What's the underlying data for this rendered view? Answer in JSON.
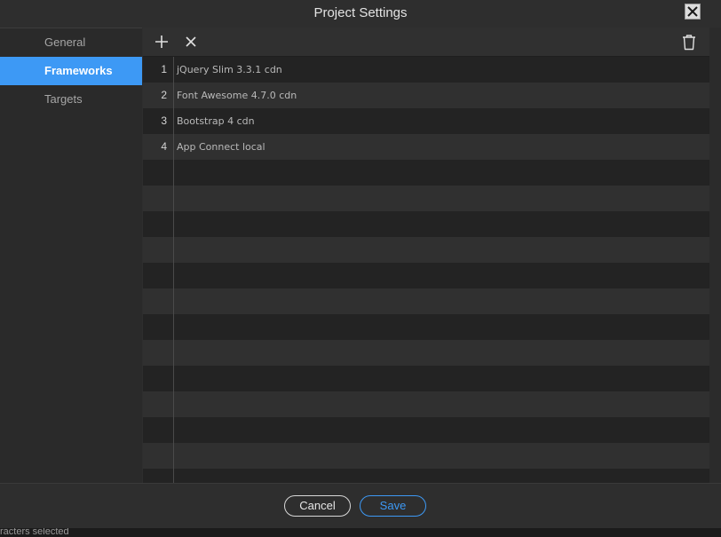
{
  "dialog": {
    "title": "Project Settings",
    "close_icon": "close-icon"
  },
  "sidebar": {
    "items": [
      {
        "label": "General",
        "active": false
      },
      {
        "label": "Frameworks",
        "active": true
      },
      {
        "label": "Targets",
        "active": false
      }
    ]
  },
  "toolbar": {
    "add_icon": "plus-icon",
    "remove_icon": "x-icon",
    "delete_icon": "trash-icon"
  },
  "frameworks": [
    {
      "num": "1",
      "name": "jQuery Slim 3.3.1 cdn"
    },
    {
      "num": "2",
      "name": "Font Awesome 4.7.0 cdn"
    },
    {
      "num": "3",
      "name": "Bootstrap 4 cdn"
    },
    {
      "num": "4",
      "name": "App Connect local"
    }
  ],
  "footer": {
    "cancel_label": "Cancel",
    "save_label": "Save"
  },
  "statusbar": {
    "text": "racters selected"
  },
  "colors": {
    "accent": "#3d99f5",
    "background": "#2e2e2e",
    "row_dark": "#232323",
    "row_light": "#303030"
  }
}
